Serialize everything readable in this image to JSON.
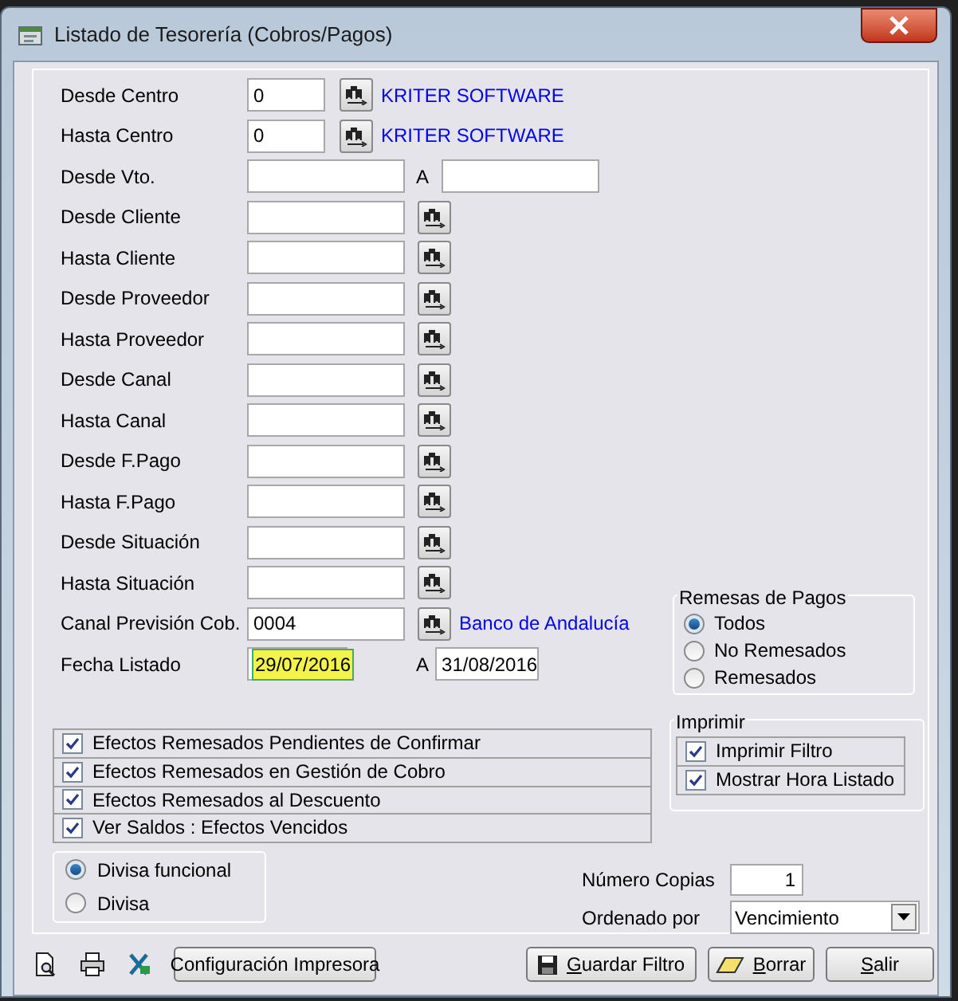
{
  "window": {
    "title": "Listado de Tesorería (Cobros/Pagos)"
  },
  "fields": [
    {
      "label": "Desde Centro",
      "kind": "code",
      "value": "0",
      "lookup": true,
      "description": "KRITER SOFTWARE"
    },
    {
      "label": "Hasta Centro",
      "kind": "code",
      "value": "0",
      "lookup": true,
      "description": "KRITER SOFTWARE"
    },
    {
      "label": "Desde Vto.",
      "kind": "range",
      "separator": "A"
    },
    {
      "label": "Desde Cliente",
      "kind": "text",
      "lookup": true
    },
    {
      "label": "Hasta Cliente",
      "kind": "text",
      "lookup": true
    },
    {
      "label": "Desde Proveedor",
      "kind": "text",
      "lookup": true
    },
    {
      "label": "Hasta Proveedor",
      "kind": "text",
      "lookup": true
    },
    {
      "label": "Desde Canal",
      "kind": "text",
      "lookup": true
    },
    {
      "label": "Hasta Canal",
      "kind": "text",
      "lookup": true
    },
    {
      "label": "Desde F.Pago",
      "kind": "text",
      "lookup": true
    },
    {
      "label": "Hasta F.Pago",
      "kind": "text",
      "lookup": true
    },
    {
      "label": "Desde Situación",
      "kind": "text",
      "lookup": true
    },
    {
      "label": "Hasta Situación",
      "kind": "text",
      "lookup": true
    },
    {
      "label": "Canal Previsión Cob.",
      "kind": "text",
      "value": "0004",
      "lookup": true,
      "description": "Banco de Andalucía"
    },
    {
      "label": "Fecha Listado",
      "kind": "date",
      "value": "29/07/2016",
      "value_selected": true,
      "separator": "A",
      "to_value": "31/08/2016"
    }
  ],
  "remesas": {
    "title": "Remesas de Pagos",
    "options": [
      {
        "label": "Todos",
        "selected": true
      },
      {
        "label": "No Remesados",
        "selected": false
      },
      {
        "label": "Remesados",
        "selected": false
      }
    ]
  },
  "checks": [
    {
      "label": "Efectos Remesados Pendientes de Confirmar",
      "checked": true
    },
    {
      "label": "Efectos Remesados en Gestión de Cobro",
      "checked": true
    },
    {
      "label": "Efectos Remesados al Descuento",
      "checked": true
    },
    {
      "label": "Ver Saldos : Efectos Vencidos",
      "checked": true
    }
  ],
  "imprimir": {
    "title": "Imprimir",
    "options": [
      {
        "label": "Imprimir Filtro",
        "checked": true
      },
      {
        "label": "Mostrar Hora Listado",
        "checked": true
      }
    ]
  },
  "divisa": {
    "options": [
      {
        "label": "Divisa funcional",
        "selected": true
      },
      {
        "label": "Divisa",
        "selected": false
      }
    ]
  },
  "copies": {
    "label": "Número Copias",
    "value": "1"
  },
  "order": {
    "label": "Ordenado por",
    "value": "Vencimiento"
  },
  "buttons": [
    {
      "label": "Configuración Impresora",
      "kind": "plain",
      "mnemonic": false
    },
    {
      "label": "Guardar Filtro",
      "kind": "save",
      "mnemonic": true
    },
    {
      "label": "Borrar",
      "kind": "erase",
      "mnemonic": true
    },
    {
      "label": "Salir",
      "kind": "plain",
      "mnemonic": true
    }
  ]
}
